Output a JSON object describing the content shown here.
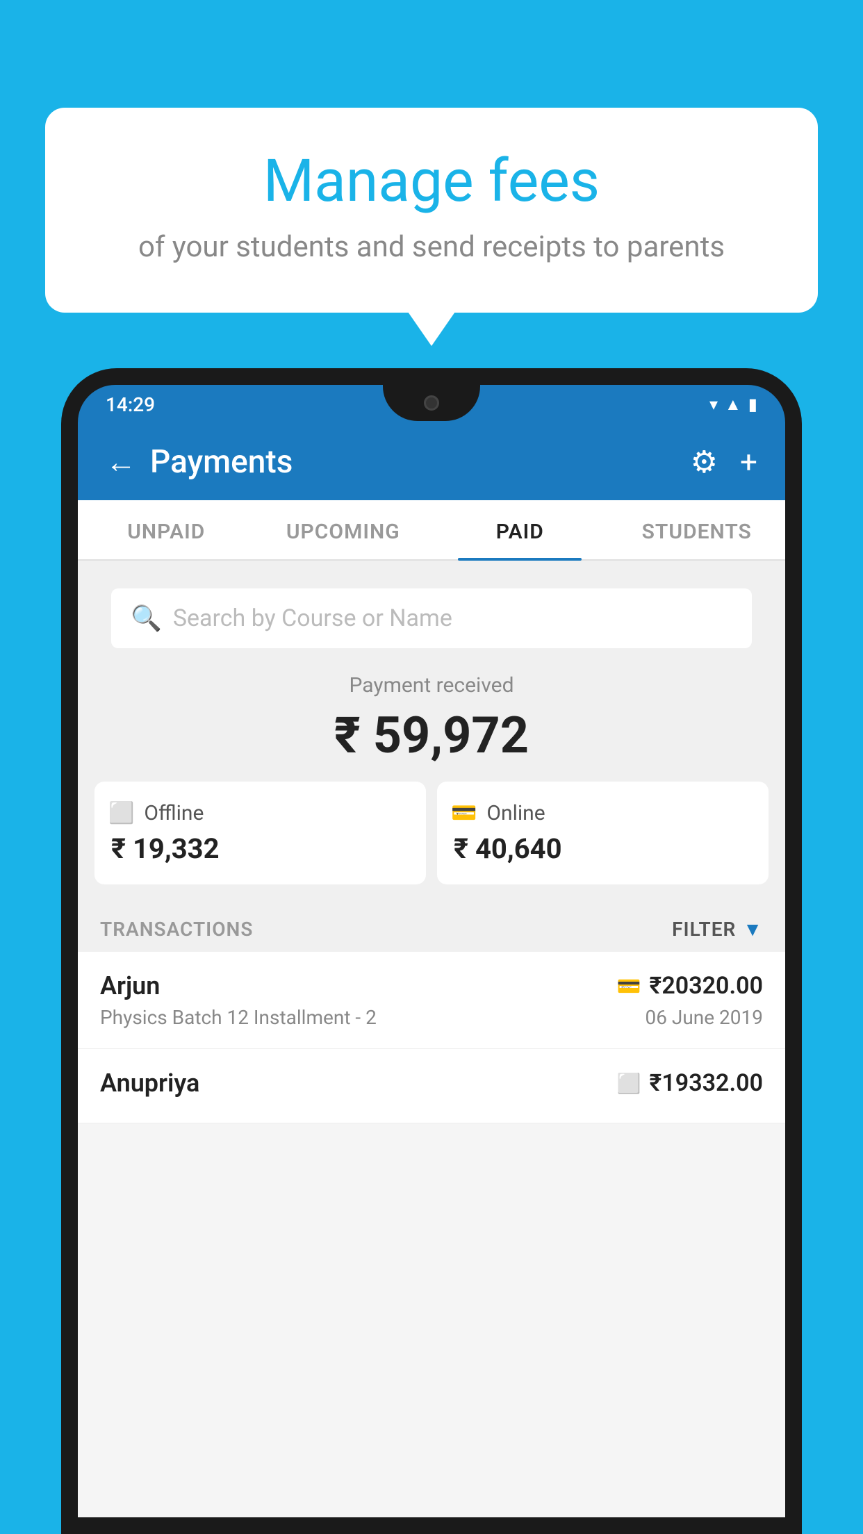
{
  "background_color": "#1ab3e8",
  "speech_bubble": {
    "title": "Manage fees",
    "subtitle": "of your students and send receipts to parents"
  },
  "phone": {
    "status_bar": {
      "time": "14:29",
      "wifi_icon": "wifi",
      "signal_icon": "signal",
      "battery_icon": "battery"
    },
    "header": {
      "back_label": "←",
      "title": "Payments",
      "settings_icon": "⚙",
      "add_icon": "+"
    },
    "tabs": [
      {
        "label": "UNPAID",
        "active": false
      },
      {
        "label": "UPCOMING",
        "active": false
      },
      {
        "label": "PAID",
        "active": true
      },
      {
        "label": "STUDENTS",
        "active": false
      }
    ],
    "search": {
      "placeholder": "Search by Course or Name"
    },
    "payment_summary": {
      "label": "Payment received",
      "total": "₹ 59,972",
      "offline": {
        "label": "Offline",
        "amount": "₹ 19,332"
      },
      "online": {
        "label": "Online",
        "amount": "₹ 40,640"
      }
    },
    "transactions": {
      "header_label": "TRANSACTIONS",
      "filter_label": "FILTER",
      "rows": [
        {
          "name": "Arjun",
          "amount": "₹20320.00",
          "description": "Physics Batch 12 Installment - 2",
          "date": "06 June 2019",
          "payment_mode": "card"
        },
        {
          "name": "Anupriya",
          "amount": "₹19332.00",
          "description": "",
          "date": "",
          "payment_mode": "offline"
        }
      ]
    }
  }
}
